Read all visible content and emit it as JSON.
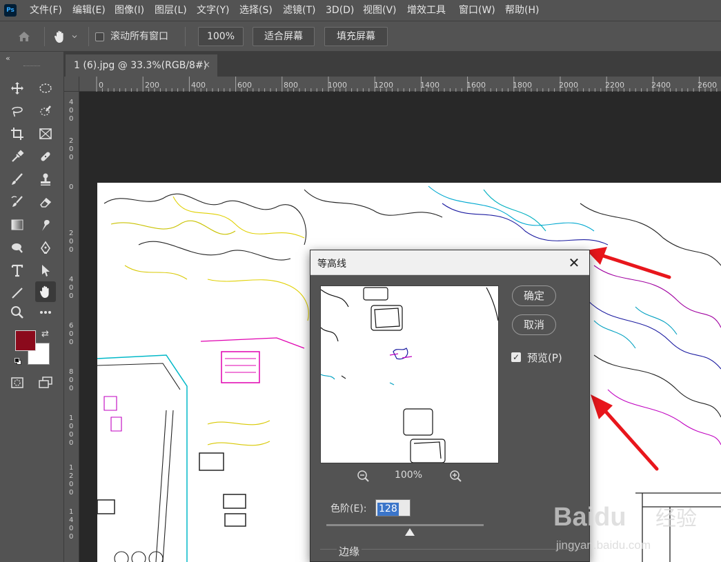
{
  "app": {
    "logo": "Ps",
    "accent": "#31a8ff"
  },
  "menu": {
    "items": [
      "文件(F)",
      "编辑(E)",
      "图像(I)",
      "图层(L)",
      "文字(Y)",
      "选择(S)",
      "滤镜(T)",
      "3D(D)",
      "视图(V)",
      "增效工具",
      "窗口(W)",
      "帮助(H)"
    ]
  },
  "options": {
    "scroll_all_label": "滚动所有窗口",
    "zoom_btn": "100%",
    "fit_btn": "适合屏幕",
    "fill_btn": "填充屏幕"
  },
  "document": {
    "tab_title": "1 (6).jpg @ 33.3%(RGB/8#)",
    "close_glyph": "×"
  },
  "rulers": {
    "horizontal": [
      "0",
      "200",
      "400",
      "600",
      "800",
      "1000",
      "1200",
      "1400",
      "1600",
      "1800",
      "2000",
      "2200",
      "2400",
      "2600"
    ],
    "vertical": [
      "4\n0\n0",
      "2\n0\n0",
      "0",
      "2\n0\n0",
      "4\n0\n0",
      "6\n0\n0",
      "8\n0\n0",
      "1\n0\n0\n0",
      "1\n2\n0\n0",
      "1\n4\n0\n0"
    ]
  },
  "colors": {
    "foreground": "#8b0a1c",
    "background": "#ffffff"
  },
  "dialog": {
    "title": "等高线",
    "ok": "确定",
    "cancel": "取消",
    "preview_label": "预览(P)",
    "preview_checked": true,
    "zoom": "100%",
    "level_label": "色阶(E):",
    "level_value": "128",
    "level_fraction": 0.5,
    "edge_label": "边缘"
  },
  "watermark": {
    "brand": "Baidu",
    "cn": "经验",
    "url": "jingyan.baidu.com"
  }
}
